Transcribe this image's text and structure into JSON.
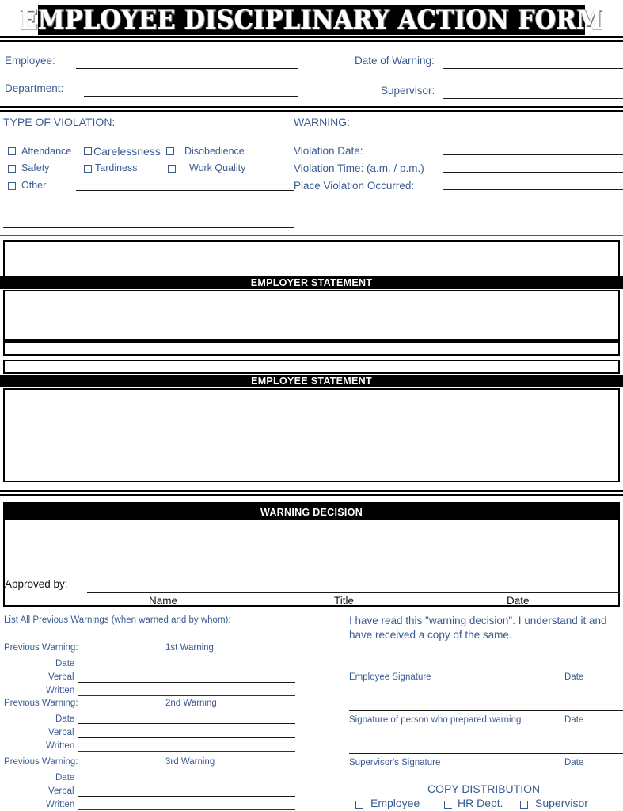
{
  "title": "EMPLOYEE DISCIPLINARY ACTION FORM",
  "header_fields": {
    "employee": "Employee:",
    "department": "Department:",
    "date_of_warning": "Date of Warning:",
    "supervisor": "Supervisor:"
  },
  "violation": {
    "heading": "TYPE OF VIOLATION:",
    "options": [
      "Attendance",
      "Carelessness",
      "Disobedience",
      "Safety",
      "Tardiness",
      "Work Quality",
      "Other"
    ]
  },
  "warning": {
    "heading": "WARNING:",
    "fields": [
      "Violation Date:",
      "Violation Time: (a.m. / p.m.)",
      "Place Violation Occurred:"
    ]
  },
  "sections": {
    "employer_statement": "EMPLOYER STATEMENT",
    "employee_statement": "EMPLOYEE STATEMENT",
    "warning_decision": "WARNING DECISION"
  },
  "approval": {
    "approved_by": "Approved by:",
    "columns": [
      "Name",
      "Title",
      "Date"
    ]
  },
  "previous_warnings": {
    "heading": "List All Previous Warnings (when warned and by whom):",
    "rows": [
      {
        "label": "Previous Warning:",
        "ordinal": "1st Warning",
        "lines": [
          "Date",
          "Verbal",
          "Written"
        ]
      },
      {
        "label": "Previous Warning:",
        "ordinal": "2nd Warning",
        "lines": [
          "Date",
          "Verbal",
          "Written"
        ]
      },
      {
        "label": "Previous Warning:",
        "ordinal": "3rd Warning",
        "lines": [
          "Date",
          "Verbal",
          "Written"
        ]
      }
    ]
  },
  "acknowledgement": {
    "text": "I have read this \"warning decision\". I understand it and have received a copy of the same.",
    "signatures": [
      {
        "label": "Employee Signature",
        "date": "Date"
      },
      {
        "label": "Signature of person who prepared warning",
        "date": "Date"
      },
      {
        "label": "Supervisor's Signature",
        "date": "Date"
      }
    ]
  },
  "copy_distribution": {
    "title": "COPY DISTRIBUTION",
    "items": [
      "Employee",
      "HR Dept.",
      "Supervisor"
    ]
  },
  "colors": {
    "text_blue": "#3a5b92",
    "text_black": "#111111",
    "band": "#000000",
    "band_text": "#ffffff"
  }
}
